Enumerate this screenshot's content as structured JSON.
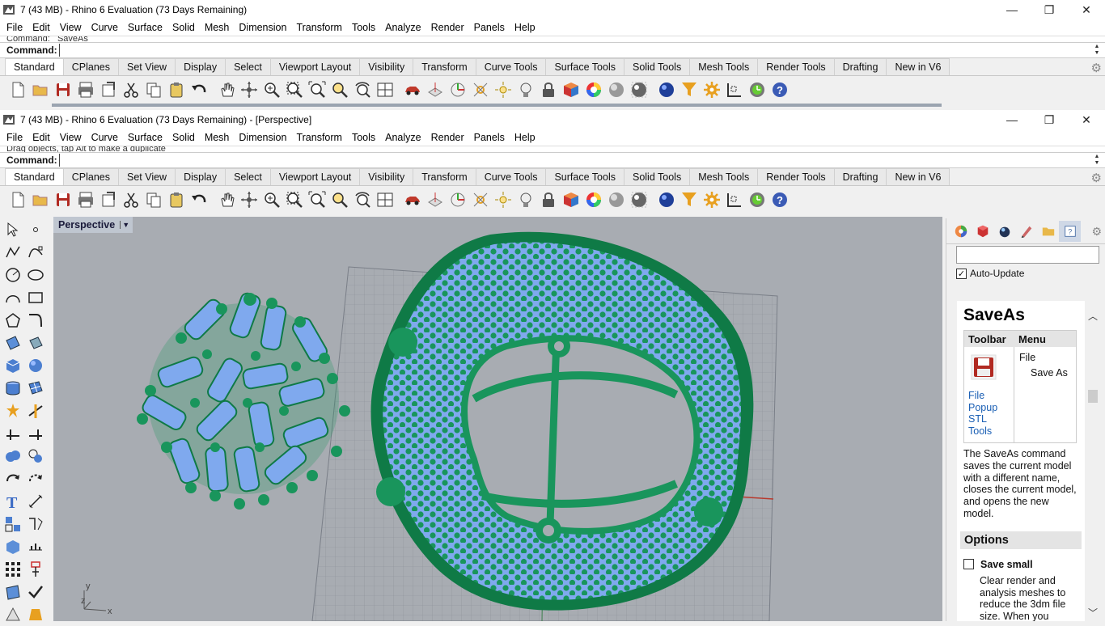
{
  "windows": [
    {
      "title": "7 (43 MB) - Rhino 6 Evaluation (73 Days Remaining)",
      "history_text": "Command: _SaveAs",
      "command_label": "Command:",
      "command_value": ""
    },
    {
      "title": "7 (43 MB) - Rhino 6 Evaluation (73 Days Remaining) - [Perspective]",
      "history_text": "Drag objects, tap Alt to make a duplicate",
      "command_label": "Command:",
      "command_value": ""
    }
  ],
  "menu": [
    "File",
    "Edit",
    "View",
    "Curve",
    "Surface",
    "Solid",
    "Mesh",
    "Dimension",
    "Transform",
    "Tools",
    "Analyze",
    "Render",
    "Panels",
    "Help"
  ],
  "window_buttons": {
    "minimize": "—",
    "restore": "❐",
    "close": "✕"
  },
  "toolbar_tabs": [
    "Standard",
    "CPlanes",
    "Set View",
    "Display",
    "Select",
    "Viewport Layout",
    "Visibility",
    "Transform",
    "Curve Tools",
    "Surface Tools",
    "Solid Tools",
    "Mesh Tools",
    "Render Tools",
    "Drafting",
    "New in V6"
  ],
  "active_tab": "Standard",
  "standard_tools": [
    "new-file",
    "open-file",
    "save",
    "print",
    "import",
    "cut",
    "copy",
    "paste",
    "undo",
    "pan",
    "rotate-view",
    "zoom-dynamic",
    "zoom-window",
    "zoom-extents",
    "zoom-selected",
    "rotate-camera",
    "four-viewports",
    "car-render",
    "toggle-cplane",
    "gumball",
    "osnap",
    "point-light",
    "bulb",
    "lock",
    "materials",
    "color-wheel",
    "shaded-sphere",
    "rendered-sphere",
    "blue-sphere",
    "select-filter",
    "options-gear",
    "layout",
    "render-clock",
    "help"
  ],
  "viewport": {
    "title": "Perspective",
    "axis_labels": {
      "x": "x",
      "y": "y",
      "z": "z"
    }
  },
  "right_panel": {
    "tabs": [
      "properties-color",
      "material",
      "render-sphere",
      "pen",
      "folder",
      "help"
    ],
    "auto_update_label": "Auto-Update",
    "auto_update_checked": true,
    "help": {
      "title": "SaveAs",
      "table_header_toolbar": "Toolbar",
      "table_header_menu": "Menu",
      "menu_path_1": "File",
      "menu_path_2": "Save As",
      "toolbar_links": [
        "File",
        "Popup",
        "STL",
        "Tools"
      ],
      "description": "The SaveAs command saves the current model with a different name, closes the current model, and opens the new model.",
      "options_heading": "Options",
      "save_small_label": "Save small",
      "save_small_desc": "Clear render and analysis meshes to reduce the 3dm file size. When you"
    }
  },
  "colors": {
    "model_green": "#19955c",
    "model_blue": "#7fa9ee",
    "viewport_bg": "#a8acb2",
    "x_axis": "#b83a2e",
    "link": "#1a5fb4"
  }
}
